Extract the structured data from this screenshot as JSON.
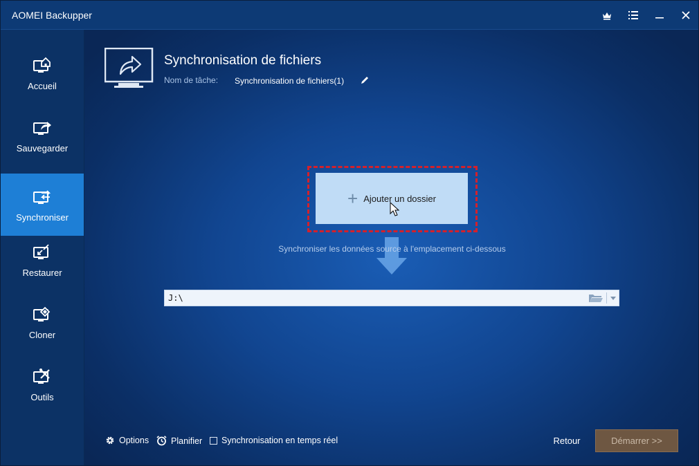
{
  "app": {
    "title": "AOMEI Backupper"
  },
  "titlebar": {
    "icons": [
      "crown-icon",
      "menu-icon",
      "minimize-icon",
      "close-icon"
    ]
  },
  "sidebar": {
    "items": [
      {
        "label": "Accueil",
        "icon": "home-monitor-icon",
        "active": false
      },
      {
        "label": "Sauvegarder",
        "icon": "backup-monitor-icon",
        "active": false
      },
      {
        "label": "Synchroniser",
        "icon": "sync-monitor-icon",
        "active": true
      },
      {
        "label": "Restaurer",
        "icon": "restore-monitor-icon",
        "active": false
      },
      {
        "label": "Cloner",
        "icon": "clone-monitor-icon",
        "active": false
      },
      {
        "label": "Outils",
        "icon": "tools-monitor-icon",
        "active": false
      }
    ]
  },
  "main": {
    "title": "Synchronisation de fichiers",
    "task_label": "Nom de tâche:",
    "task_value": "Synchronisation de fichiers(1)",
    "add_folder_label": "Ajouter un dossier",
    "sync_hint": "Synchroniser les données source à l'emplacement ci-dessous",
    "destination_value": "J:\\"
  },
  "footer": {
    "options_label": "Options",
    "schedule_label": "Planifier",
    "realtime_label": "Synchronisation en temps réel",
    "realtime_checked": false,
    "back_label": "Retour",
    "start_label": "Démarrer >>"
  },
  "colors": {
    "accent": "#1e7fd6",
    "highlight": "#d5202a",
    "start_button": "#6e5742"
  }
}
